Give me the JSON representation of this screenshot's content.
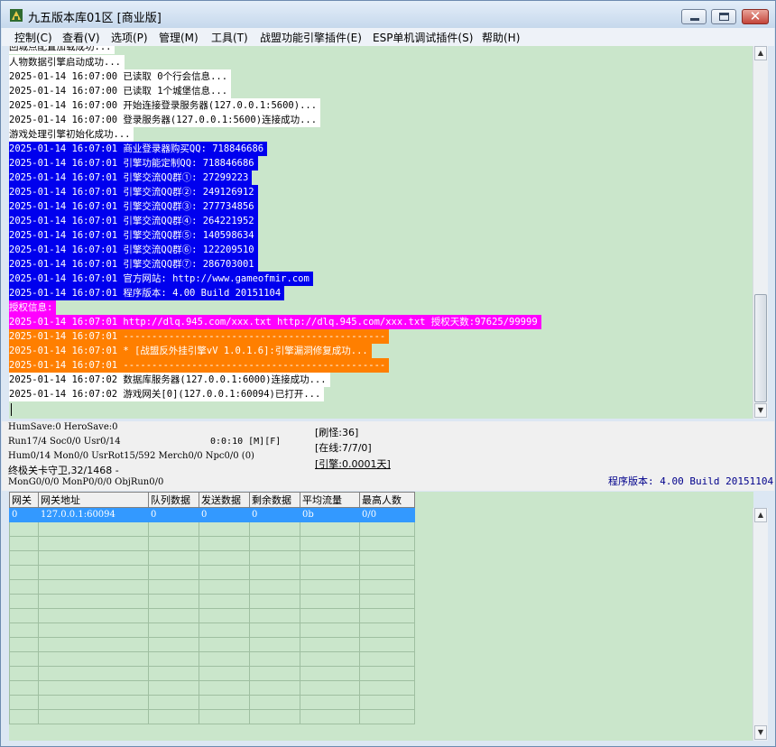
{
  "window": {
    "title": "九五版本库01区 [商业版]"
  },
  "menu": [
    "控制(C)",
    "查看(V)",
    "选项(P)",
    "管理(M)",
    "工具(T)",
    "战盟功能引擎插件(E)",
    "ESP单机调试插件(S)",
    "帮助(H)"
  ],
  "log": [
    {
      "text": "回城点配置加载成功...",
      "style": "white"
    },
    {
      "text": "人物数据引擎启动成功...",
      "style": "white"
    },
    {
      "text": "2025-01-14 16:07:00 已读取 0个行会信息...",
      "style": "white"
    },
    {
      "text": "2025-01-14 16:07:00 已读取 1个城堡信息...",
      "style": "white"
    },
    {
      "text": "2025-01-14 16:07:00 开始连接登录服务器(127.0.0.1:5600)...",
      "style": "white"
    },
    {
      "text": "2025-01-14 16:07:00 登录服务器(127.0.0.1:5600)连接成功...",
      "style": "white"
    },
    {
      "text": "游戏处理引擎初始化成功...",
      "style": "white"
    },
    {
      "text": "2025-01-14 16:07:01 商业登录器购买QQ: 718846686",
      "style": "blue"
    },
    {
      "text": "2025-01-14 16:07:01 引擎功能定制QQ: 718846686",
      "style": "blue"
    },
    {
      "text": "2025-01-14 16:07:01 引擎交流QQ群①: 27299223",
      "style": "blue"
    },
    {
      "text": "2025-01-14 16:07:01 引擎交流QQ群②: 249126912",
      "style": "blue"
    },
    {
      "text": "2025-01-14 16:07:01 引擎交流QQ群③: 277734856",
      "style": "blue"
    },
    {
      "text": "2025-01-14 16:07:01 引擎交流QQ群④: 264221952",
      "style": "blue"
    },
    {
      "text": "2025-01-14 16:07:01 引擎交流QQ群⑤: 140598634",
      "style": "blue"
    },
    {
      "text": "2025-01-14 16:07:01 引擎交流QQ群⑥: 122209510",
      "style": "blue"
    },
    {
      "text": "2025-01-14 16:07:01 引擎交流QQ群⑦: 286703001",
      "style": "blue"
    },
    {
      "text": "2025-01-14 16:07:01 官方网站: http://www.gameofmir.com",
      "style": "blue"
    },
    {
      "text": "2025-01-14 16:07:01 程序版本: 4.00 Build 20151104",
      "style": "blue"
    },
    {
      "text": "授权信息:",
      "style": "magenta"
    },
    {
      "text": "2025-01-14 16:07:01 http://dlq.945.com/xxx.txt http://dlq.945.com/xxx.txt 授权天数:97625/99999",
      "style": "magenta"
    },
    {
      "text": "2025-01-14 16:07:01 ----------------------------------------------",
      "style": "orange"
    },
    {
      "text": "2025-01-14 16:07:01 * [战盟反外挂引擎vV 1.0.1.6]:引擎漏洞修复成功...",
      "style": "orange"
    },
    {
      "text": "2025-01-14 16:07:01 ----------------------------------------------",
      "style": "orange"
    },
    {
      "text": "2025-01-14 16:07:02 数据库服务器(127.0.0.1:6000)连接成功...",
      "style": "white"
    },
    {
      "text": "2025-01-14 16:07:02 游戏网关[0](127.0.0.1:60094)已打开...",
      "style": "white"
    }
  ],
  "status": {
    "line1": "HumSave:0 HeroSave:0",
    "line2": "Run17/4 Soc0/0 Usr0/14",
    "time": "0:0:10 [M][F]",
    "line3": "Hum0/14 Mon0/0 UsrRot15/592 Merch0/0 Npc0/0 (0)",
    "line4": "终极关卡守卫,32/1468 -",
    "line5": "MonG0/0/0 MonP0/0/0 ObjRun0/0",
    "refresh": "[刷怪:36]",
    "online": "[在线:7/7/0]",
    "engine": "[引擎:0.0001天]",
    "version": "程序版本: 4.00 Build 20151104"
  },
  "gateway_table": {
    "headers": [
      "网关",
      "网关地址",
      "队列数据",
      "发送数据",
      "剩余数据",
      "平均流量",
      "最高人数"
    ],
    "rows": [
      [
        "0",
        "127.0.0.1:60094",
        "0",
        "0",
        "0",
        "0b",
        "0/0"
      ]
    ]
  },
  "colors": {
    "log_bg": "#cae6cb",
    "blue": "#0000ee",
    "magenta": "#ff00ff",
    "orange": "#ff7f00",
    "selection": "#3399ff"
  },
  "icons": {
    "app": "app-icon",
    "minimize": "minimize-icon",
    "maximize": "maximize-icon",
    "close": "close-icon",
    "scroll_up": "arrow-up-icon",
    "scroll_down": "arrow-down-icon"
  }
}
